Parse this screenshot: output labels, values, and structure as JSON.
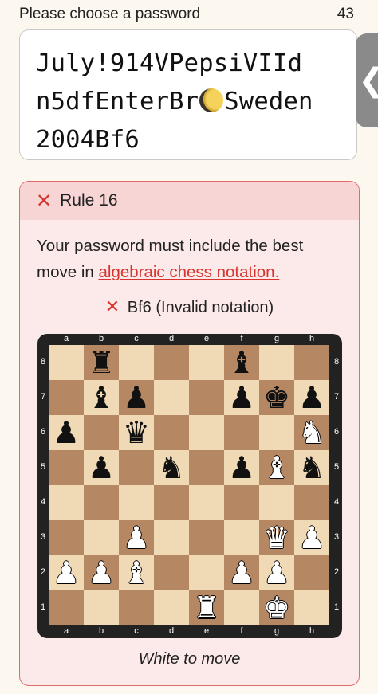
{
  "header": {
    "prompt": "Please choose a password",
    "char_count": "43"
  },
  "password": {
    "line1": "July!914VPepsiVIId",
    "line2_a": "n5dfEnterBr",
    "line2_moon": "moon-emoji",
    "line2_b": "Sweden",
    "line3": "2004Bf6"
  },
  "side_tab": {
    "icon": "chevron-left",
    "glyph": "❮"
  },
  "rule": {
    "title": "Rule 16",
    "text_before": "Your password must include the best move in ",
    "link_text": "algebraic chess notation.",
    "status_text": "Bf6 (Invalid notation)",
    "turn_text": "White to move"
  },
  "board": {
    "files": [
      "a",
      "b",
      "c",
      "d",
      "e",
      "f",
      "g",
      "h"
    ],
    "ranks": [
      "8",
      "7",
      "6",
      "5",
      "4",
      "3",
      "2",
      "1"
    ],
    "position": [
      [
        "",
        "bR",
        "",
        "",
        "",
        "bB",
        "",
        ""
      ],
      [
        "",
        "bB",
        "bP",
        "",
        "",
        "bP",
        "bK",
        "bP"
      ],
      [
        "bP",
        "",
        "bQ",
        "",
        "",
        "",
        "",
        "wN"
      ],
      [
        "",
        "bP",
        "",
        "bN",
        "",
        "bP",
        "wB",
        "bN"
      ],
      [
        "",
        "",
        "",
        "",
        "",
        "",
        "",
        ""
      ],
      [
        "",
        "",
        "wP",
        "",
        "",
        "",
        "wQ",
        "wP"
      ],
      [
        "wP",
        "wP",
        "wB",
        "",
        "",
        "wP",
        "wP",
        ""
      ],
      [
        "",
        "",
        "",
        "",
        "wR",
        "",
        "wK",
        ""
      ]
    ]
  },
  "colors": {
    "light_square": "#f0d9b5",
    "dark_square": "#b58863",
    "error": "#d8342f",
    "card_bg": "#fce9e9"
  }
}
